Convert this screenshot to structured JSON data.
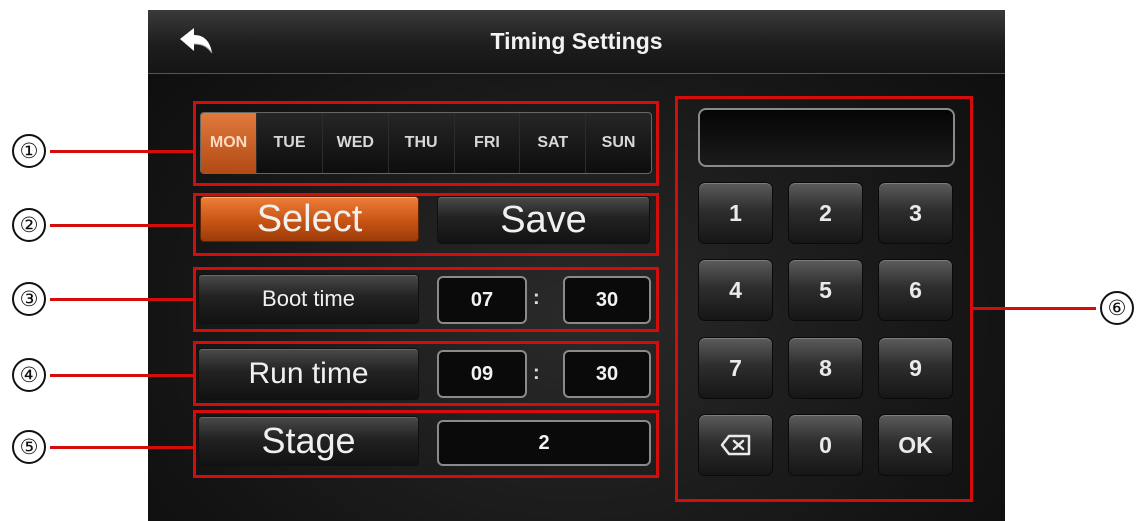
{
  "header": {
    "title": "Timing Settings"
  },
  "days": [
    "MON",
    "TUE",
    "WED",
    "THU",
    "FRI",
    "SAT",
    "SUN"
  ],
  "selected_day": "MON",
  "actions": {
    "select_label": "Select",
    "save_label": "Save"
  },
  "boot_time": {
    "label": "Boot time",
    "hour": "07",
    "separator": ":",
    "minute": "30"
  },
  "run_time": {
    "label": "Run time",
    "hour": "09",
    "separator": ":",
    "minute": "30"
  },
  "stage": {
    "label": "Stage",
    "value": "2"
  },
  "keypad": {
    "display": "",
    "keys": [
      "1",
      "2",
      "3",
      "4",
      "5",
      "6",
      "7",
      "8",
      "9",
      "backspace-icon",
      "0",
      "OK"
    ]
  },
  "annotations": [
    "①",
    "②",
    "③",
    "④",
    "⑤",
    "⑥"
  ],
  "colors": {
    "accent": "#c85413",
    "callout_red": "#d40c0c",
    "background": "#141414"
  }
}
